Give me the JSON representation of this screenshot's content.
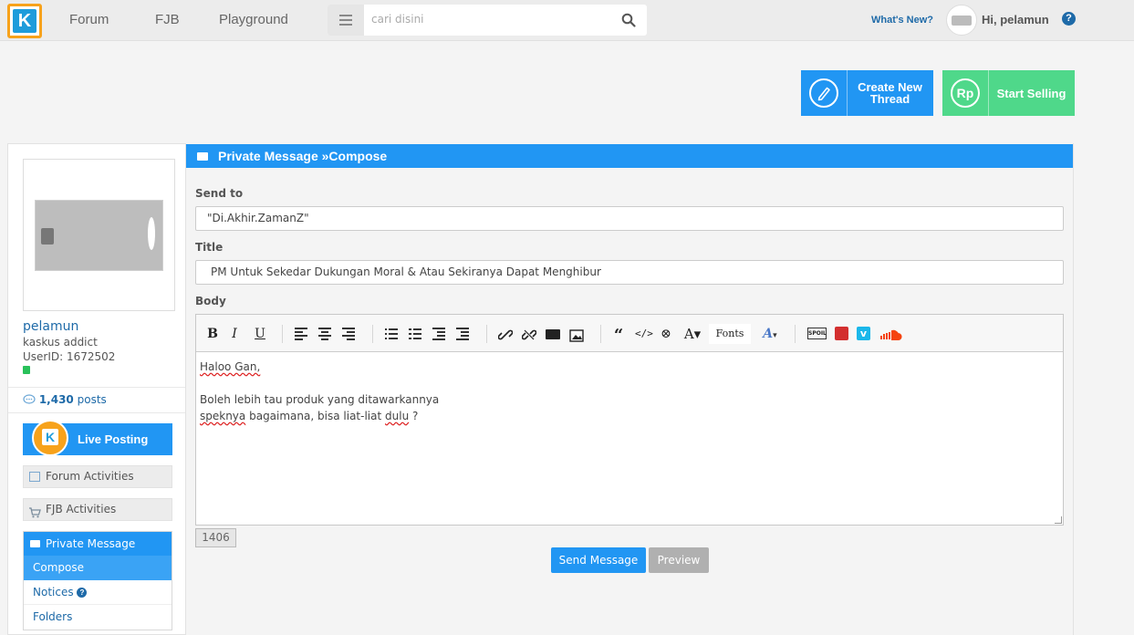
{
  "nav": {
    "logo_letter": "K",
    "links": [
      "Forum",
      "FJB",
      "Playground"
    ],
    "search_placeholder": "cari disini",
    "whats_new": "What's New?",
    "greeting": "Hi, pelamun",
    "help": "?"
  },
  "actions": {
    "create_thread": "Create New Thread",
    "start_selling": "Start Selling",
    "rp_symbol": "Rp"
  },
  "profile": {
    "username": "pelamun",
    "rank": "kaskus addict",
    "user_id": "UserID: 1672502",
    "posts_count": "1,430",
    "posts_label": "posts"
  },
  "sidebar": {
    "live_posting": "Live Posting",
    "forum_activities": "Forum Activities",
    "fjb_activities": "FJB Activities",
    "private_message": "Private Message",
    "compose": "Compose",
    "notices": "Notices",
    "folders": "Folders"
  },
  "compose": {
    "header": "Private Message »Compose",
    "send_to_label": "Send to",
    "send_to_value": "\"Di.Akhir.ZamanZ\"",
    "title_label": "Title",
    "title_value": "PM Untuk Sekedar Dukungan Moral & Atau Sekiranya Dapat Menghibur",
    "body_label": "Body",
    "fonts_label": "Fonts",
    "body_lines": [
      "Haloo Gan,",
      "",
      "Boleh lebih tau produk yang ditawarkannya",
      "speknya bagaimana, bisa liat-liat dulu ?"
    ],
    "char_count": "1406",
    "send_button": "Send Message",
    "preview_button": "Preview"
  },
  "colors": {
    "brand_blue": "#2196f3",
    "sell_green": "#4fd88a",
    "logo_orange": "#f7a21b"
  }
}
